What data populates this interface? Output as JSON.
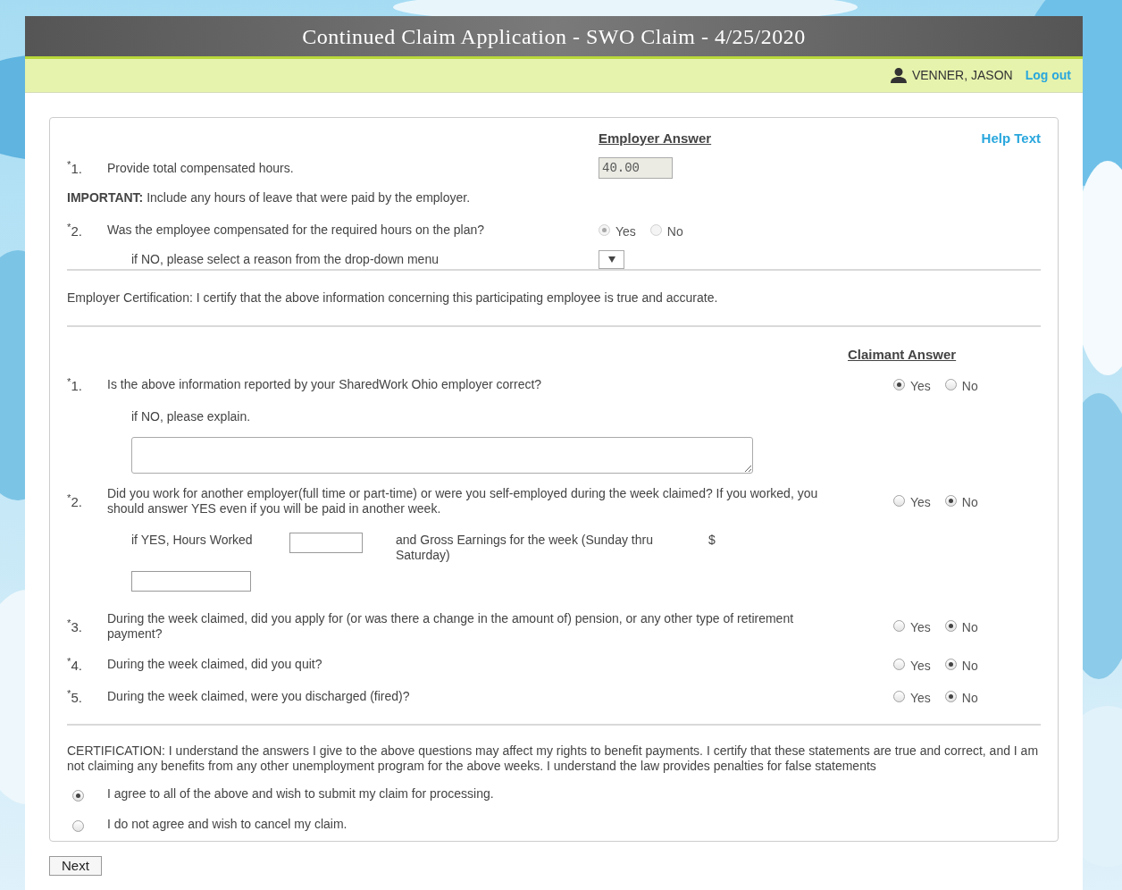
{
  "header": {
    "title": "Continued Claim Application - SWO Claim - 4/25/2020",
    "user": "VENNER, JASON",
    "logout": "Log out"
  },
  "employer": {
    "heading": "Employer Answer",
    "help": "Help Text",
    "questions": [
      {
        "kind": "value",
        "number": "$^{*}$1.",
        "text": "Provide total compensated hours.",
        "value": "40.00"
      },
      {
        "kind": "note",
        "text": "**IMPORTANT:** Include any hours of leave that were paid by the employer."
      },
      {
        "kind": "choice",
        "number": "$^{*}$2.",
        "text": "Was the employee compensated for the required hours on the plan?",
        "disabled": true,
        "options": [
          {
            "label": "Yes",
            "selected": true
          },
          {
            "label": "No",
            "selected": false
          }
        ],
        "sub": "if NO, please select a reason from the drop-down menu"
      }
    ]
  },
  "employer_certification": "Employer Certification: I certify that the above information concerning this participating employee is true and accurate.",
  "claimant": {
    "heading": "Claimant Answer",
    "questions": [
      {
        "kind": "explain",
        "number": "$^{*}$1.",
        "text": "Is the above information reported by your SharedWork Ohio employer correct?",
        "options": [
          {
            "label": "Yes",
            "selected": true
          },
          {
            "label": "No",
            "selected": false
          }
        ],
        "sub": "if NO, please explain."
      },
      {
        "kind": "earnings",
        "number": "$^{*}$2.",
        "text": "Did you work for another employer(full time or part-time) or were you self-employed during the week claimed? If you worked, you should answer YES even if you will be paid in another week.",
        "options": [
          {
            "label": "Yes",
            "selected": false
          },
          {
            "label": "No",
            "selected": true
          }
        ],
        "hours_label": "if YES, Hours Worked",
        "earnings_label": "and Gross Earnings for the week (Sunday thru Saturday)",
        "currency": "$"
      },
      {
        "kind": "plain",
        "number": "$^{*}$3.",
        "text": "During the week claimed, did you apply for (or was there a change in the amount of) pension, or any other type of retirement payment?",
        "options": [
          {
            "label": "Yes",
            "selected": false
          },
          {
            "label": "No",
            "selected": true
          }
        ]
      },
      {
        "kind": "plain",
        "number": "$^{*}$4.",
        "text": "During the week claimed, did you quit?",
        "options": [
          {
            "label": "Yes",
            "selected": false
          },
          {
            "label": "No",
            "selected": true
          }
        ]
      },
      {
        "kind": "plain",
        "number": "$^{*}$5.",
        "text": "During the week claimed, were you discharged (fired)?",
        "options": [
          {
            "label": "Yes",
            "selected": false
          },
          {
            "label": "No",
            "selected": true
          }
        ]
      }
    ]
  },
  "certification": "CERTIFICATION: I understand the answers I give to the above questions may affect my rights to benefit payments. I certify that these statements are true and correct, and I am not claiming any benefits from any other unemployment program for the above weeks. I understand the law provides penalties for false statements",
  "agreement": [
    {
      "label": "I agree to all of the above and wish to submit my claim for processing.",
      "selected": true
    },
    {
      "label": "I do not agree and wish to cancel my claim.",
      "selected": false
    }
  ],
  "next": "Next"
}
